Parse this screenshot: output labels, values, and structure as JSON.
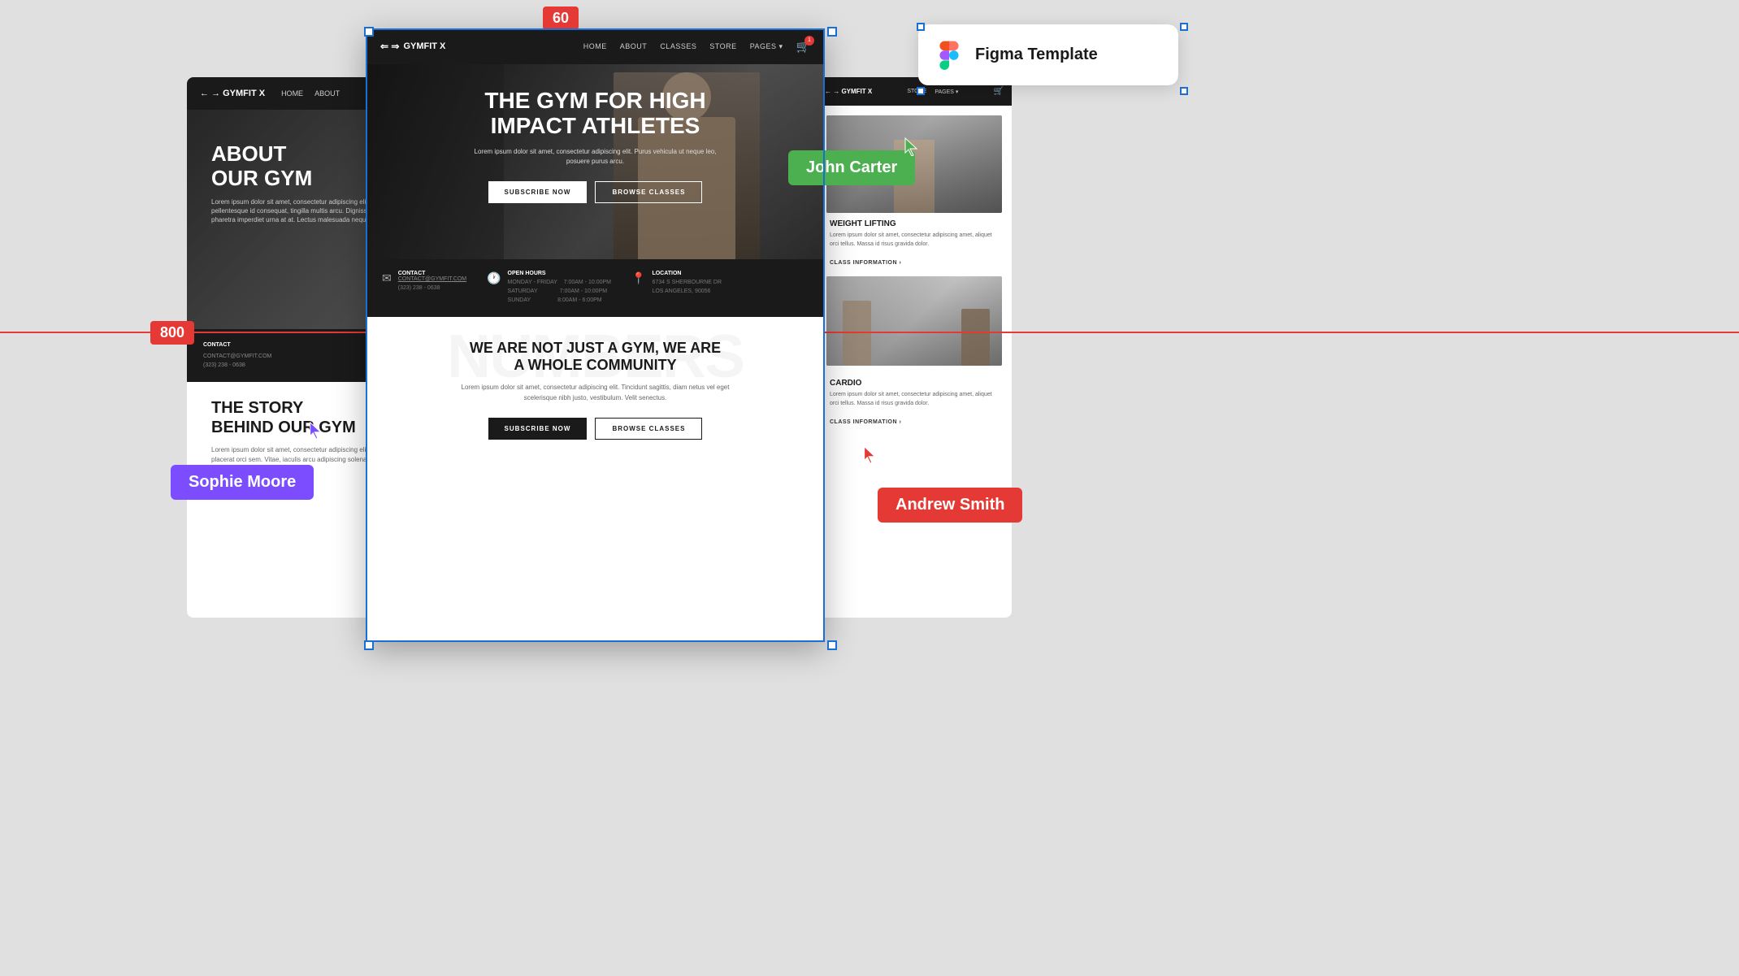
{
  "canvas": {
    "background_color": "#e0e0e0"
  },
  "labels": {
    "top_number": "60",
    "side_number": "800"
  },
  "figma_card": {
    "logo_alt": "Figma logo",
    "title": "Figma Template"
  },
  "badges": {
    "john_carter": "John Carter",
    "sophie_moore": "Sophie Moore",
    "andrew_smith": "Andrew Smith"
  },
  "main_card": {
    "nav": {
      "logo": "← → GYMFIT X",
      "items": [
        "HOME",
        "ABOUT",
        "CLASSES",
        "STORE",
        "PAGES ▾"
      ],
      "cart_count": "1"
    },
    "hero": {
      "title": "THE GYM FOR HIGH IMPACT ATHLETES",
      "description": "Lorem ipsum dolor sit amet, consectetur adipiscing elit. Purus vehicula ut neque leo, posuere purus arcu.",
      "btn_subscribe": "SUBSCRIBE NOW",
      "btn_browse": "BROWSE CLASSES"
    },
    "info_bar": {
      "contact_label": "CONTACT",
      "contact_email": "CONTACT@GYMFIT.COM",
      "contact_phone": "(323) 238 - 0638",
      "hours_label": "OPEN HOURS",
      "hours_mf": "MONDAY - FRIDAY    7:00AM - 10:00PM",
      "hours_sat": "SATURDAY               7:00AM - 10:00PM",
      "hours_sun": "SUNDAY                   8:00AM - 6:00PM",
      "location_label": "LOCATION",
      "location_addr": "6734 S SHERBOURNE DR\nLOS ANGELES, 90056"
    },
    "community": {
      "watermark": "NUMBERS",
      "title": "WE ARE NOT JUST A GYM, WE ARE\nA WHOLE COMMUNITY",
      "text": "Lorem ipsum dolor sit amet, consectetur adipiscing elit. Tincidunt sagittis, diam netus vel eget scelerisque nibh justo, vestibulum. Velit senectus.",
      "btn_subscribe": "SUBSCRIBE NOW",
      "btn_browse": "BROWSE CLASSES"
    }
  },
  "left_card": {
    "nav": {
      "logo": "← → GYMFIT X",
      "items": [
        "HOME",
        "ABOUT"
      ]
    },
    "hero": {
      "title": "ABOUT\nOUR GYM"
    },
    "about": {
      "title": "THE STORY\nBEHIND OUR GYM",
      "text": "Lorem ipsum dolor sit amet, consectetur adipiscing elit. Commodo lacis marti sed sagittis arcu. In turniaque, placerat orci sem. Vitae, iaculis arcu adipiscing solenat malesuada nattique. Lectus arcu quis morbi ut nibh fusce."
    }
  },
  "right_card": {
    "nav": {
      "logo": "← → GYMFIT X",
      "items": [
        "STORE",
        "PAGES ▾"
      ]
    },
    "section1": {
      "title": "WEIGHT LIFTING",
      "text": "Lorem ipsum dolor sit amet, consectetur adipiscing amet, aliquet orci tellus. Massa id risus gravida dolor.",
      "link": "CLASS INFORMATION ›"
    },
    "section2": {
      "title": "CARDIO",
      "text": "Lorem ipsum dolor sit amet, consectetur adipiscing amet, aliquet orci tellus. Massa id risus gravida dolor.",
      "link": "CLASS INFORMATION ›"
    }
  },
  "colors": {
    "accent_blue": "#1a6fd4",
    "accent_red": "#e53935",
    "accent_green": "#4caf50",
    "accent_purple": "#7c4dff",
    "dark_nav": "#1a1a1a",
    "white": "#ffffff"
  }
}
